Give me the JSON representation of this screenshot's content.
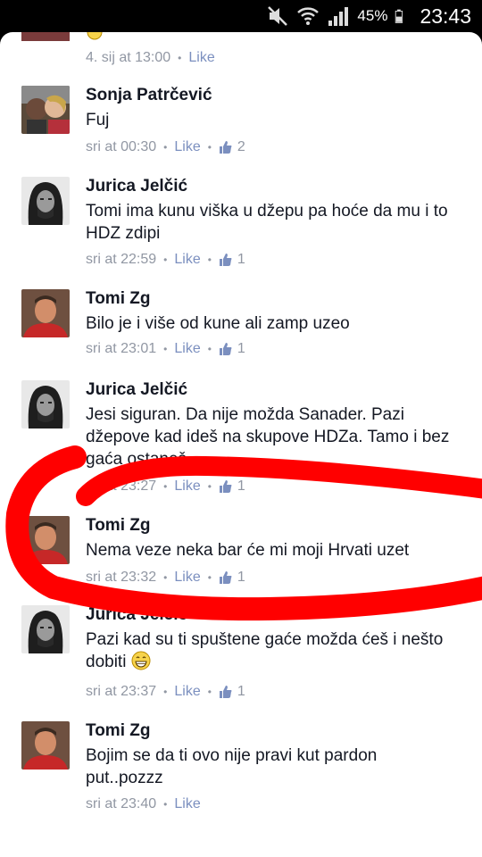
{
  "status_bar": {
    "battery_percent": "45%",
    "time": "23:43"
  },
  "prev_comment": {
    "time": "4. sij at 13:00",
    "like_label": "Like"
  },
  "comments": [
    {
      "author": "Sonja Patrčević",
      "text": "Fuj",
      "time": "sri at 00:30",
      "like_label": "Like",
      "likes": "2",
      "avatar": "couple-photo"
    },
    {
      "author": "Jurica Jelčić",
      "text": "Tomi ima kunu viška u džepu pa hoće da mu i to HDZ zdipi",
      "time": "sri at 22:59",
      "like_label": "Like",
      "likes": "1",
      "avatar": "bw-portrait"
    },
    {
      "author": "Tomi Zg",
      "text": "Bilo je i više od kune ali zamp uzeo",
      "time": "sri at 23:01",
      "like_label": "Like",
      "likes": "1",
      "avatar": "red-shirt-portrait"
    },
    {
      "author": "Jurica Jelčić",
      "text": "Jesi siguran. Da nije možda Sanader. Pazi džepove kad ideš na skupove HDZa. Tamo i bez gaća ostaneš",
      "time": "sri at 23:27",
      "like_label": "Like",
      "likes": "1",
      "avatar": "bw-portrait"
    },
    {
      "author": "Tomi Zg",
      "text": "Nema veze neka bar će mi moji Hrvati uzet",
      "time": "sri at 23:32",
      "like_label": "Like",
      "likes": "1",
      "avatar": "red-shirt-portrait"
    },
    {
      "author": "Jurica Jelčić",
      "text": "Pazi kad su ti spuštene gaće možda ćeš i nešto dobiti",
      "time": "sri at 23:37",
      "like_label": "Like",
      "likes": "1",
      "avatar": "bw-portrait",
      "emoji": "grin-emoji"
    },
    {
      "author": "Tomi Zg",
      "text": "Bojim se da ti ovo nije pravi kut pardon put..pozzz",
      "time": "sri at 23:40",
      "like_label": "Like",
      "avatar": "red-shirt-portrait"
    }
  ],
  "colors": {
    "annotation_red": "#ff0000",
    "link_blue": "#7b8fbf",
    "meta_gray": "#9197a3"
  }
}
